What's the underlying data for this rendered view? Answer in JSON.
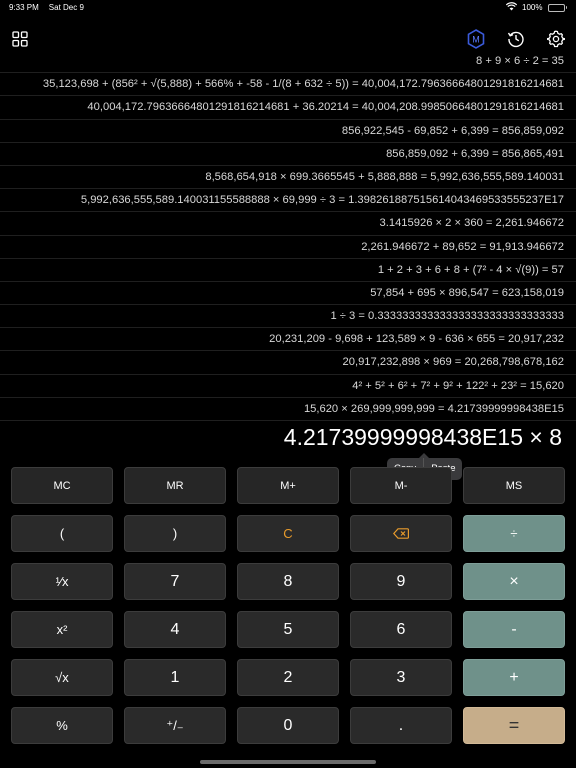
{
  "status": {
    "time": "9:33 PM",
    "date": "Sat Dec 9",
    "battery": "100%"
  },
  "toolbar": {
    "memory_badge": "M"
  },
  "history": [
    "8 + 9 × 6 ÷ 2 = 35",
    "35,123,698 + (856² + √(5,888) + 566% + -58 - 1/(8 + 632 ÷ 5)) = 40,004,172.796366648012918162146​81",
    "40,004,172.79636664801291816214681 + 36.20214 = 40,004,208.99850664801291816214681",
    "856,922,545 - 69,852 + 6,399 = 856,859,092",
    "856,859,092 + 6,399 = 856,865,491",
    "8,568,654,918 × 699.3665545 + 5,888,888 = 5,992,636,555,589.140031",
    "5,992,636,555,589.140031155588888 × 69,999 ÷ 3 = 1.3982618875156140434695335552​37E17",
    "3.1415926 × 2 × 360 = 2,261.946672",
    "2,261.946672 + 89,652 = 91,913.946672",
    "1 + 2 + 3 + 6 + 8 + (7² - 4 × √(9)) = 57",
    "57,854 + 695 × 896,547 = 623,158,019",
    "1 ÷ 3 = 0.333333333333333333333333333333",
    "20,231,209 - 9,698 + 123,589 × 9 - 636 × 655 = 20,917,232",
    "20,917,232,898 × 969 = 20,268,798,678,162",
    "4² + 5² + 6² + 7² + 9² + 122² + 23² = 15,620",
    "15,620 × 269,999,999,999 = 4.21739999998438E15"
  ],
  "display": {
    "expression": "4.21739999998438E15 × 8"
  },
  "context_menu": {
    "copy": "Copy",
    "paste": "Paste"
  },
  "keys": {
    "mc": "MC",
    "mr": "MR",
    "mplus": "M+",
    "mminus": "M-",
    "ms": "MS",
    "lparen": "(",
    "rparen": ")",
    "clear": "C",
    "divide": "÷",
    "reciprocal": "¹⁄x",
    "seven": "7",
    "eight": "8",
    "nine": "9",
    "multiply": "×",
    "square": "x²",
    "four": "4",
    "five": "5",
    "six": "6",
    "minus": "-",
    "sqrt": "√x",
    "one": "1",
    "two": "2",
    "three": "3",
    "plus": "+",
    "percent": "%",
    "negate": "⁺/₋",
    "zero": "0",
    "decimal": ".",
    "equals": "="
  },
  "colors": {
    "operator": "#6f918a",
    "equals": "#c6ad8a",
    "clear": "#e89b2c",
    "memory_badge": "#3b5bdb"
  }
}
